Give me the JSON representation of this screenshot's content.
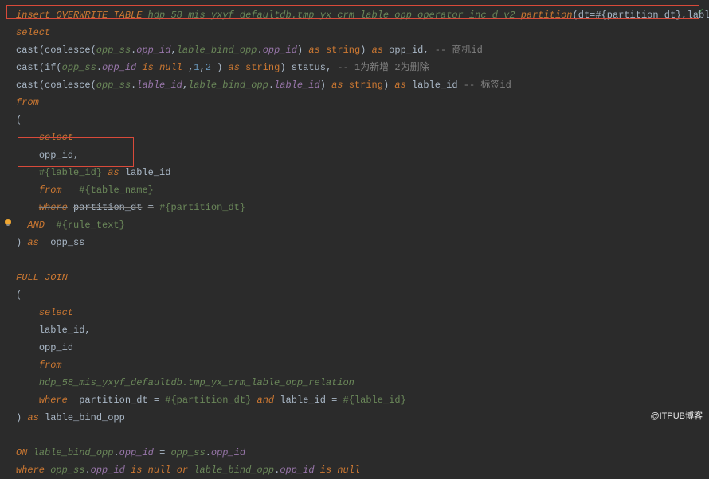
{
  "line1": {
    "insert": "insert",
    "overwrite": "OVERWRITE",
    "table_kw": "TABLE",
    "table_name": "hdp_58_mis_yxyf_defaultdb.tmp_yx_crm_lable_opp_operator_inc_d_v2",
    "partition_kw": "partition",
    "partition_args": "(dt=#{partition_dt},lable_id )"
  },
  "line2": {
    "select": "select"
  },
  "line3": {
    "cast": "cast",
    "coalesce": "coalesce",
    "a1": "opp_ss",
    "c1": "opp_id",
    "a2": "lable_bind_opp",
    "c2": "opp_id",
    "as1": "as",
    "string": "string",
    "as2": "as",
    "alias": "opp_id",
    "comment": "-- 商机id"
  },
  "line4": {
    "cast": "cast",
    "if": "if",
    "a1": "opp_ss",
    "c1": "opp_id",
    "is_null": "is null",
    "n1": "1",
    "n2": "2",
    "as1": "as",
    "string": "string",
    "alias": "status",
    "comment": "-- 1为新增 2为删除"
  },
  "line5": {
    "cast": "cast",
    "coalesce": "coalesce",
    "a1": "opp_ss",
    "c1": "lable_id",
    "a2": "lable_bind_opp",
    "c2": "lable_id",
    "as1": "as",
    "string": "string",
    "as2": "as",
    "alias": "lable_id",
    "comment": "-- 标签id"
  },
  "line6": {
    "from": "from"
  },
  "line7": {
    "paren": "("
  },
  "line8": {
    "select": "select"
  },
  "line9": {
    "col": "opp_id,"
  },
  "line10": {
    "expr": "#{lable_id}",
    "as": "as",
    "alias": "lable_id"
  },
  "line11": {
    "from": "from",
    "tbl": "#{table_name}"
  },
  "line12": {
    "where": "where",
    "col": "partition_dt",
    "eq": "=",
    "val": "#{partition_dt}"
  },
  "line13": {
    "and": "AND",
    "val": "#{rule_text}"
  },
  "line14": {
    "paren": ")",
    "as": "as",
    "alias": "opp_ss"
  },
  "line16": {
    "full": "FULL",
    "join": "JOIN"
  },
  "line17": {
    "paren": "("
  },
  "line18": {
    "select": "select"
  },
  "line19": {
    "col": "lable_id,"
  },
  "line20": {
    "col": "opp_id"
  },
  "line21": {
    "from": "from"
  },
  "line22": {
    "tbl": "hdp_58_mis_yxyf_defaultdb.tmp_yx_crm_lable_opp_relation"
  },
  "line23": {
    "where": "where",
    "c1": "partition_dt",
    "eq1": "=",
    "v1": "#{partition_dt}",
    "and": "and",
    "c2": "lable_id",
    "eq2": "=",
    "v2": "#{lable_id}"
  },
  "line24": {
    "paren": ")",
    "as": "as",
    "alias": "lable_bind_opp"
  },
  "line26": {
    "on": "ON",
    "a1": "lable_bind_opp",
    "c1": "opp_id",
    "eq": "=",
    "a2": "opp_ss",
    "c2": "opp_id"
  },
  "line27": {
    "where": "where",
    "a1": "opp_ss",
    "c1": "opp_id",
    "is1": "is null",
    "or": "or",
    "a2": "lable_bind_opp",
    "c2": "opp_id",
    "is2": "is null"
  },
  "watermark": "@ITPUB博客",
  "checkmark": "✓"
}
